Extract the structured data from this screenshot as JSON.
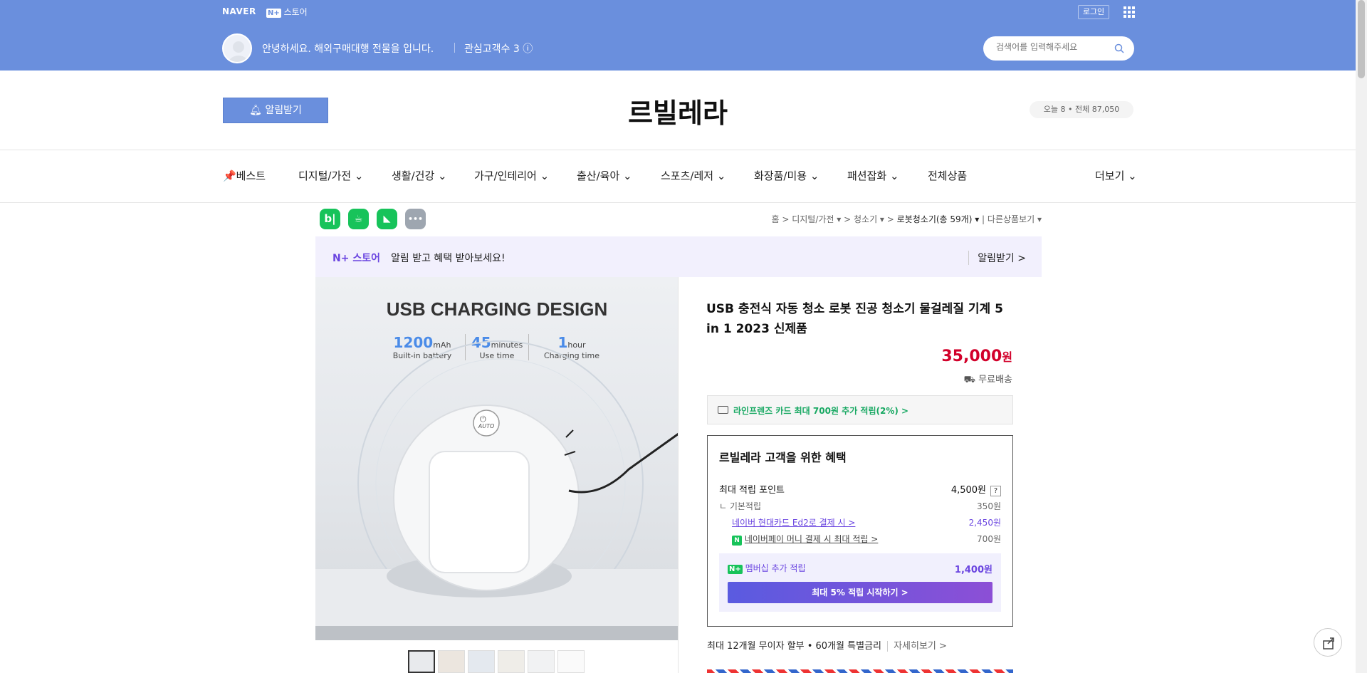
{
  "topbar": {
    "naver_label": "NAVER",
    "np_badge": "N+",
    "store_label": "스토어",
    "login_label": "로그인",
    "greeting": "안녕하세요. 해외구매대행 전물을 입니다.",
    "interest": "관심고객수 3 ⓘ",
    "search_placeholder": "검색어를 입력해주세요"
  },
  "header": {
    "alert_button": "알림받기",
    "store_name": "르빌레라",
    "visitors": "오늘 8 • 전체 87,050"
  },
  "nav": [
    {
      "label": "📌베스트"
    },
    {
      "label": "디지털/가전 ⌄"
    },
    {
      "label": "생활/건강 ⌄"
    },
    {
      "label": "가구/인테리어 ⌄"
    },
    {
      "label": "출산/육아 ⌄"
    },
    {
      "label": "스포츠/레저 ⌄"
    },
    {
      "label": "화장품/미용 ⌄"
    },
    {
      "label": "패션잡화 ⌄"
    },
    {
      "label": "전체상품"
    },
    {
      "label": "더보기 ⌄"
    }
  ],
  "share_icons": [
    {
      "name": "blog-share-icon",
      "glyph": "b|",
      "color": "#17c35a"
    },
    {
      "name": "cafe-share-icon",
      "glyph": "☕",
      "color": "#17c35a"
    },
    {
      "name": "bookmark-share-icon",
      "glyph": "◣",
      "color": "#17c35a"
    },
    {
      "name": "more-share-icon",
      "glyph": "•••",
      "color": "#9ea6b0"
    }
  ],
  "breadcrumb": {
    "home": "홈",
    "cat1": "디지털/가전 ▾",
    "cat2": "청소기 ▾",
    "cat3": "로봇청소기(총 59개) ▾",
    "other": "다른상품보기 ▾"
  },
  "promo": {
    "logo": "N+ 스토어",
    "text": "알림 받고 혜택 받아보세요!",
    "action": "알림받기 >"
  },
  "product_image": {
    "headline": "USB CHARGING DESIGN",
    "specs": [
      {
        "value": "1200",
        "unit": "mAh",
        "caption": "Built-in battery"
      },
      {
        "value": "45",
        "unit": "minutes",
        "caption": "Use time"
      },
      {
        "value": "1",
        "unit": "hour",
        "caption": "Charging time"
      }
    ],
    "auto_label": "AUTO"
  },
  "product": {
    "title": "USB 충전식 자동 청소 로봇 진공 청소기 물걸레질 기계 5 in 1 2023 신제품",
    "price": "35,000",
    "price_unit": "원",
    "shipping": "무료배송"
  },
  "card_benefit": "라인프렌즈 카드 최대 700원 추가 적립(2%) >",
  "benefits": {
    "title": "르빌레라 고객을 위한 혜택",
    "max_points_label": "최대 적립 포인트",
    "max_points_value": "4,500원",
    "qmark": "?",
    "rows": [
      {
        "label": "ㄴ 기본적립",
        "value": "350원"
      },
      {
        "label": "네이버 현대카드 Ed2로 결제 시 >",
        "value": "2,450원"
      },
      {
        "label": "네이버페이 머니 결제 시 최대 적립 >",
        "value": "700원"
      }
    ],
    "membership_label": "멤버십 추가 적립",
    "membership_value": "1,400원",
    "membership_button": "최대 5% 적립 시작하기 >",
    "np_badge": "N+",
    "npay_badge": "N"
  },
  "installment": {
    "text": "최대 12개월 무이자 할부 • 60개월 특별금리",
    "more": "자세히보기 >"
  }
}
